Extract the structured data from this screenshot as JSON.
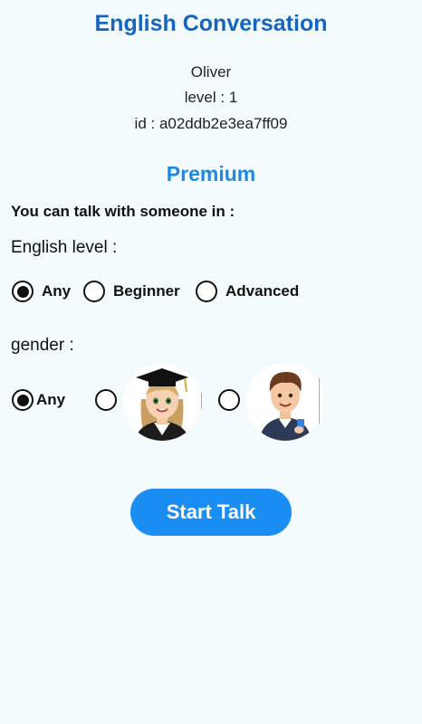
{
  "header": {
    "title": "English Conversation"
  },
  "user": {
    "name": "Oliver",
    "level": "level : 1",
    "id": "id : a02ddb2e3ea7ff09"
  },
  "plan": {
    "label": "Premium"
  },
  "filters": {
    "subtitle": "You can talk with someone in :",
    "level_label": "English level :",
    "level_options": [
      "Any",
      "Beginner",
      "Advanced"
    ],
    "level_selected": "Any",
    "gender_label": "gender :",
    "gender_options": [
      "Any",
      "female-avatar",
      "male-avatar"
    ],
    "gender_selected": "Any"
  },
  "actions": {
    "start_label": "Start Talk"
  },
  "colors": {
    "title": "#1565c0",
    "premium": "#1e88e5",
    "button": "#1a8ef2",
    "background": "#f3fbfe"
  }
}
